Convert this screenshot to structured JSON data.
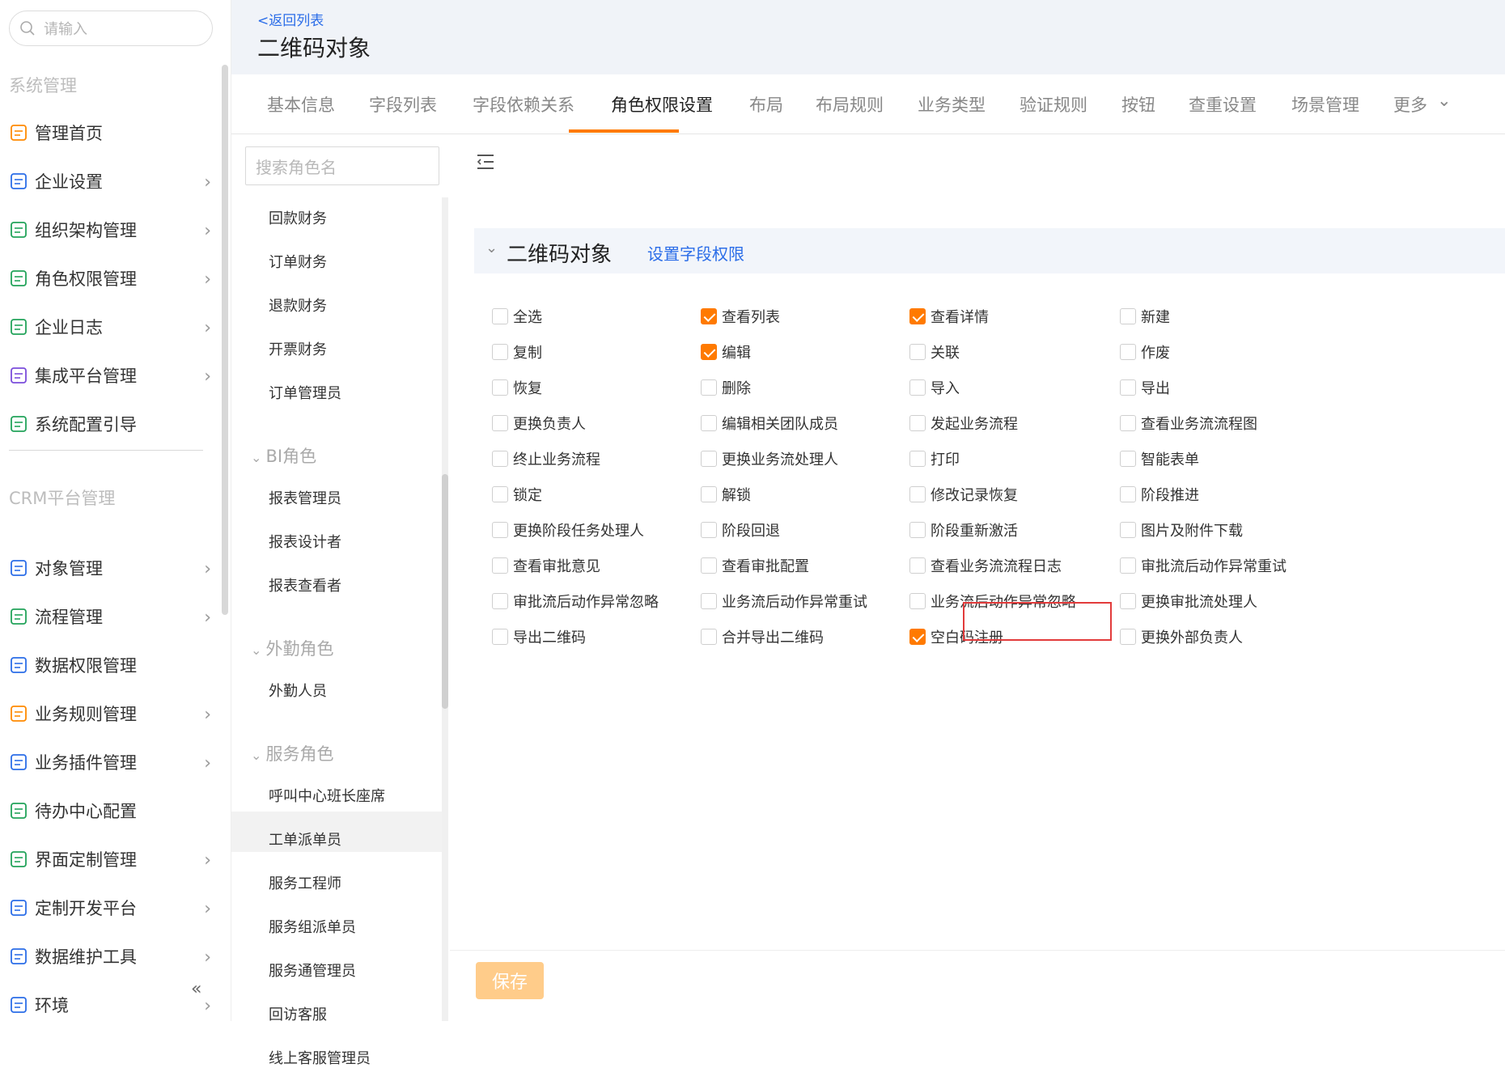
{
  "search": {
    "placeholder": "请输入"
  },
  "nav": {
    "group1_title": "系统管理",
    "group1_items": [
      {
        "label": "管理首页",
        "icon": "home-icon",
        "has_arrow": false
      },
      {
        "label": "企业设置",
        "icon": "building-settings-icon",
        "has_arrow": true
      },
      {
        "label": "组织架构管理",
        "icon": "org-tree-icon",
        "has_arrow": true
      },
      {
        "label": "角色权限管理",
        "icon": "id-card-icon",
        "has_arrow": true
      },
      {
        "label": "企业日志",
        "icon": "log-document-icon",
        "has_arrow": true
      },
      {
        "label": "集成平台管理",
        "icon": "chip-icon",
        "has_arrow": true
      },
      {
        "label": "系统配置引导",
        "icon": "signpost-icon",
        "has_arrow": false
      }
    ],
    "group2_title": "CRM平台管理",
    "group2_items": [
      {
        "label": "对象管理",
        "icon": "cube-settings-icon",
        "has_arrow": true
      },
      {
        "label": "流程管理",
        "icon": "flow-icon",
        "has_arrow": true
      },
      {
        "label": "数据权限管理",
        "icon": "data-lock-icon",
        "has_arrow": false
      },
      {
        "label": "业务规则管理",
        "icon": "wrench-icon",
        "has_arrow": true
      },
      {
        "label": "业务插件管理",
        "icon": "puzzle-icon",
        "has_arrow": true
      },
      {
        "label": "待办中心配置",
        "icon": "check-circle-icon",
        "has_arrow": false
      },
      {
        "label": "界面定制管理",
        "icon": "window-icon",
        "has_arrow": true
      },
      {
        "label": "定制开发平台",
        "icon": "code-icon",
        "has_arrow": true
      },
      {
        "label": "数据维护工具",
        "icon": "bar-chart-icon",
        "has_arrow": true
      },
      {
        "label": "环境",
        "icon": "gauge-icon",
        "has_arrow": true
      }
    ],
    "collapse_glyph": "«"
  },
  "header": {
    "back_label": "<返回列表",
    "title": "二维码对象"
  },
  "tabs": [
    "基本信息",
    "字段列表",
    "字段依赖关系",
    "角色权限设置",
    "布局",
    "布局规则",
    "业务类型",
    "验证规则",
    "按钮",
    "查重设置",
    "场景管理",
    "更多"
  ],
  "active_tab": "角色权限设置",
  "roles": {
    "search_placeholder": "搜索角色名",
    "items_top": [
      "回款财务",
      "订单财务",
      "退款财务",
      "开票财务",
      "订单管理员"
    ],
    "group_bi": "BI角色",
    "items_bi": [
      "报表管理员",
      "报表设计者",
      "报表查看者"
    ],
    "group_field": "外勤角色",
    "items_field": [
      "外勤人员"
    ],
    "group_service": "服务角色",
    "items_service": [
      "呼叫中心班长座席",
      "工单派单员",
      "服务工程师",
      "服务组派单员",
      "服务通管理员",
      "回访客服",
      "线上客服管理员"
    ],
    "selected": "服务工程师"
  },
  "section": {
    "title": "二维码对象",
    "link": "设置字段权限"
  },
  "permissions": [
    {
      "label": "全选",
      "checked": false
    },
    {
      "label": "查看列表",
      "checked": true
    },
    {
      "label": "查看详情",
      "checked": true
    },
    {
      "label": "新建",
      "checked": false
    },
    {
      "label": "复制",
      "checked": false
    },
    {
      "label": "编辑",
      "checked": true
    },
    {
      "label": "关联",
      "checked": false
    },
    {
      "label": "作废",
      "checked": false
    },
    {
      "label": "恢复",
      "checked": false
    },
    {
      "label": "删除",
      "checked": false
    },
    {
      "label": "导入",
      "checked": false
    },
    {
      "label": "导出",
      "checked": false
    },
    {
      "label": "更换负责人",
      "checked": false
    },
    {
      "label": "编辑相关团队成员",
      "checked": false
    },
    {
      "label": "发起业务流程",
      "checked": false
    },
    {
      "label": "查看业务流流程图",
      "checked": false
    },
    {
      "label": "终止业务流程",
      "checked": false
    },
    {
      "label": "更换业务流处理人",
      "checked": false
    },
    {
      "label": "打印",
      "checked": false
    },
    {
      "label": "智能表单",
      "checked": false
    },
    {
      "label": "锁定",
      "checked": false
    },
    {
      "label": "解锁",
      "checked": false
    },
    {
      "label": "修改记录恢复",
      "checked": false
    },
    {
      "label": "阶段推进",
      "checked": false
    },
    {
      "label": "更换阶段任务处理人",
      "checked": false
    },
    {
      "label": "阶段回退",
      "checked": false
    },
    {
      "label": "阶段重新激活",
      "checked": false
    },
    {
      "label": "图片及附件下载",
      "checked": false
    },
    {
      "label": "查看审批意见",
      "checked": false
    },
    {
      "label": "查看审批配置",
      "checked": false
    },
    {
      "label": "查看业务流流程日志",
      "checked": false
    },
    {
      "label": "审批流后动作异常重试",
      "checked": false
    },
    {
      "label": "审批流后动作异常忽略",
      "checked": false
    },
    {
      "label": "业务流后动作异常重试",
      "checked": false
    },
    {
      "label": "业务流后动作异常忽略",
      "checked": false
    },
    {
      "label": "更换审批流处理人",
      "checked": false
    },
    {
      "label": "导出二维码",
      "checked": false
    },
    {
      "label": "合并导出二维码",
      "checked": false
    },
    {
      "label": "空白码注册",
      "checked": true
    },
    {
      "label": "更换外部负责人",
      "checked": false
    }
  ],
  "save_label": "保存",
  "colors": {
    "accent": "#ff7a00",
    "link": "#2b6de8",
    "highlight": "#e23b3b",
    "nav_icon": "#2b6de8"
  }
}
